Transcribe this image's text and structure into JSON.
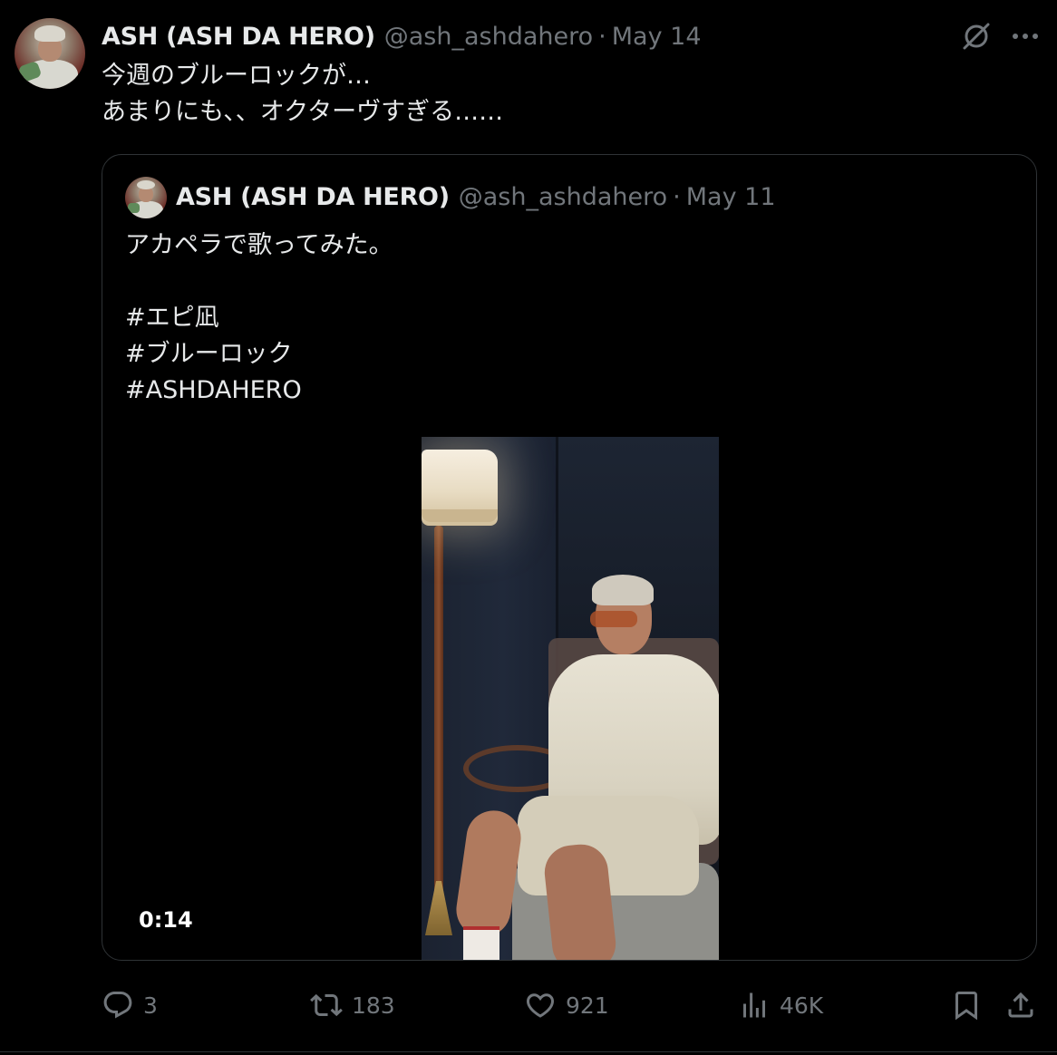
{
  "tweet": {
    "author": {
      "name": "ASH (ASH DA HERO)",
      "handle": "@ash_ashdahero",
      "separator": "·",
      "date": "May 14"
    },
    "text_lines": [
      "今週のブルーロックが…",
      "あまりにも、、オクターヴすぎる……"
    ],
    "icons": {
      "grok": "grok-icon",
      "more": "more-options-icon"
    }
  },
  "quote": {
    "author": {
      "name": "ASH (ASH DA HERO)",
      "handle": "@ash_ashdahero",
      "separator": "·",
      "date": "May 11"
    },
    "text_lines": [
      "アカペラで歌ってみた。",
      "",
      "#エピ凪",
      "#ブルーロック",
      "#ASHDAHERO"
    ],
    "video": {
      "duration": "0:14"
    }
  },
  "actions": {
    "replies": "3",
    "reposts": "183",
    "likes": "921",
    "views": "46K"
  },
  "colors": {
    "background": "#000000",
    "text_primary": "#e7e9ea",
    "text_secondary": "#71767b",
    "border": "#2f3336"
  }
}
